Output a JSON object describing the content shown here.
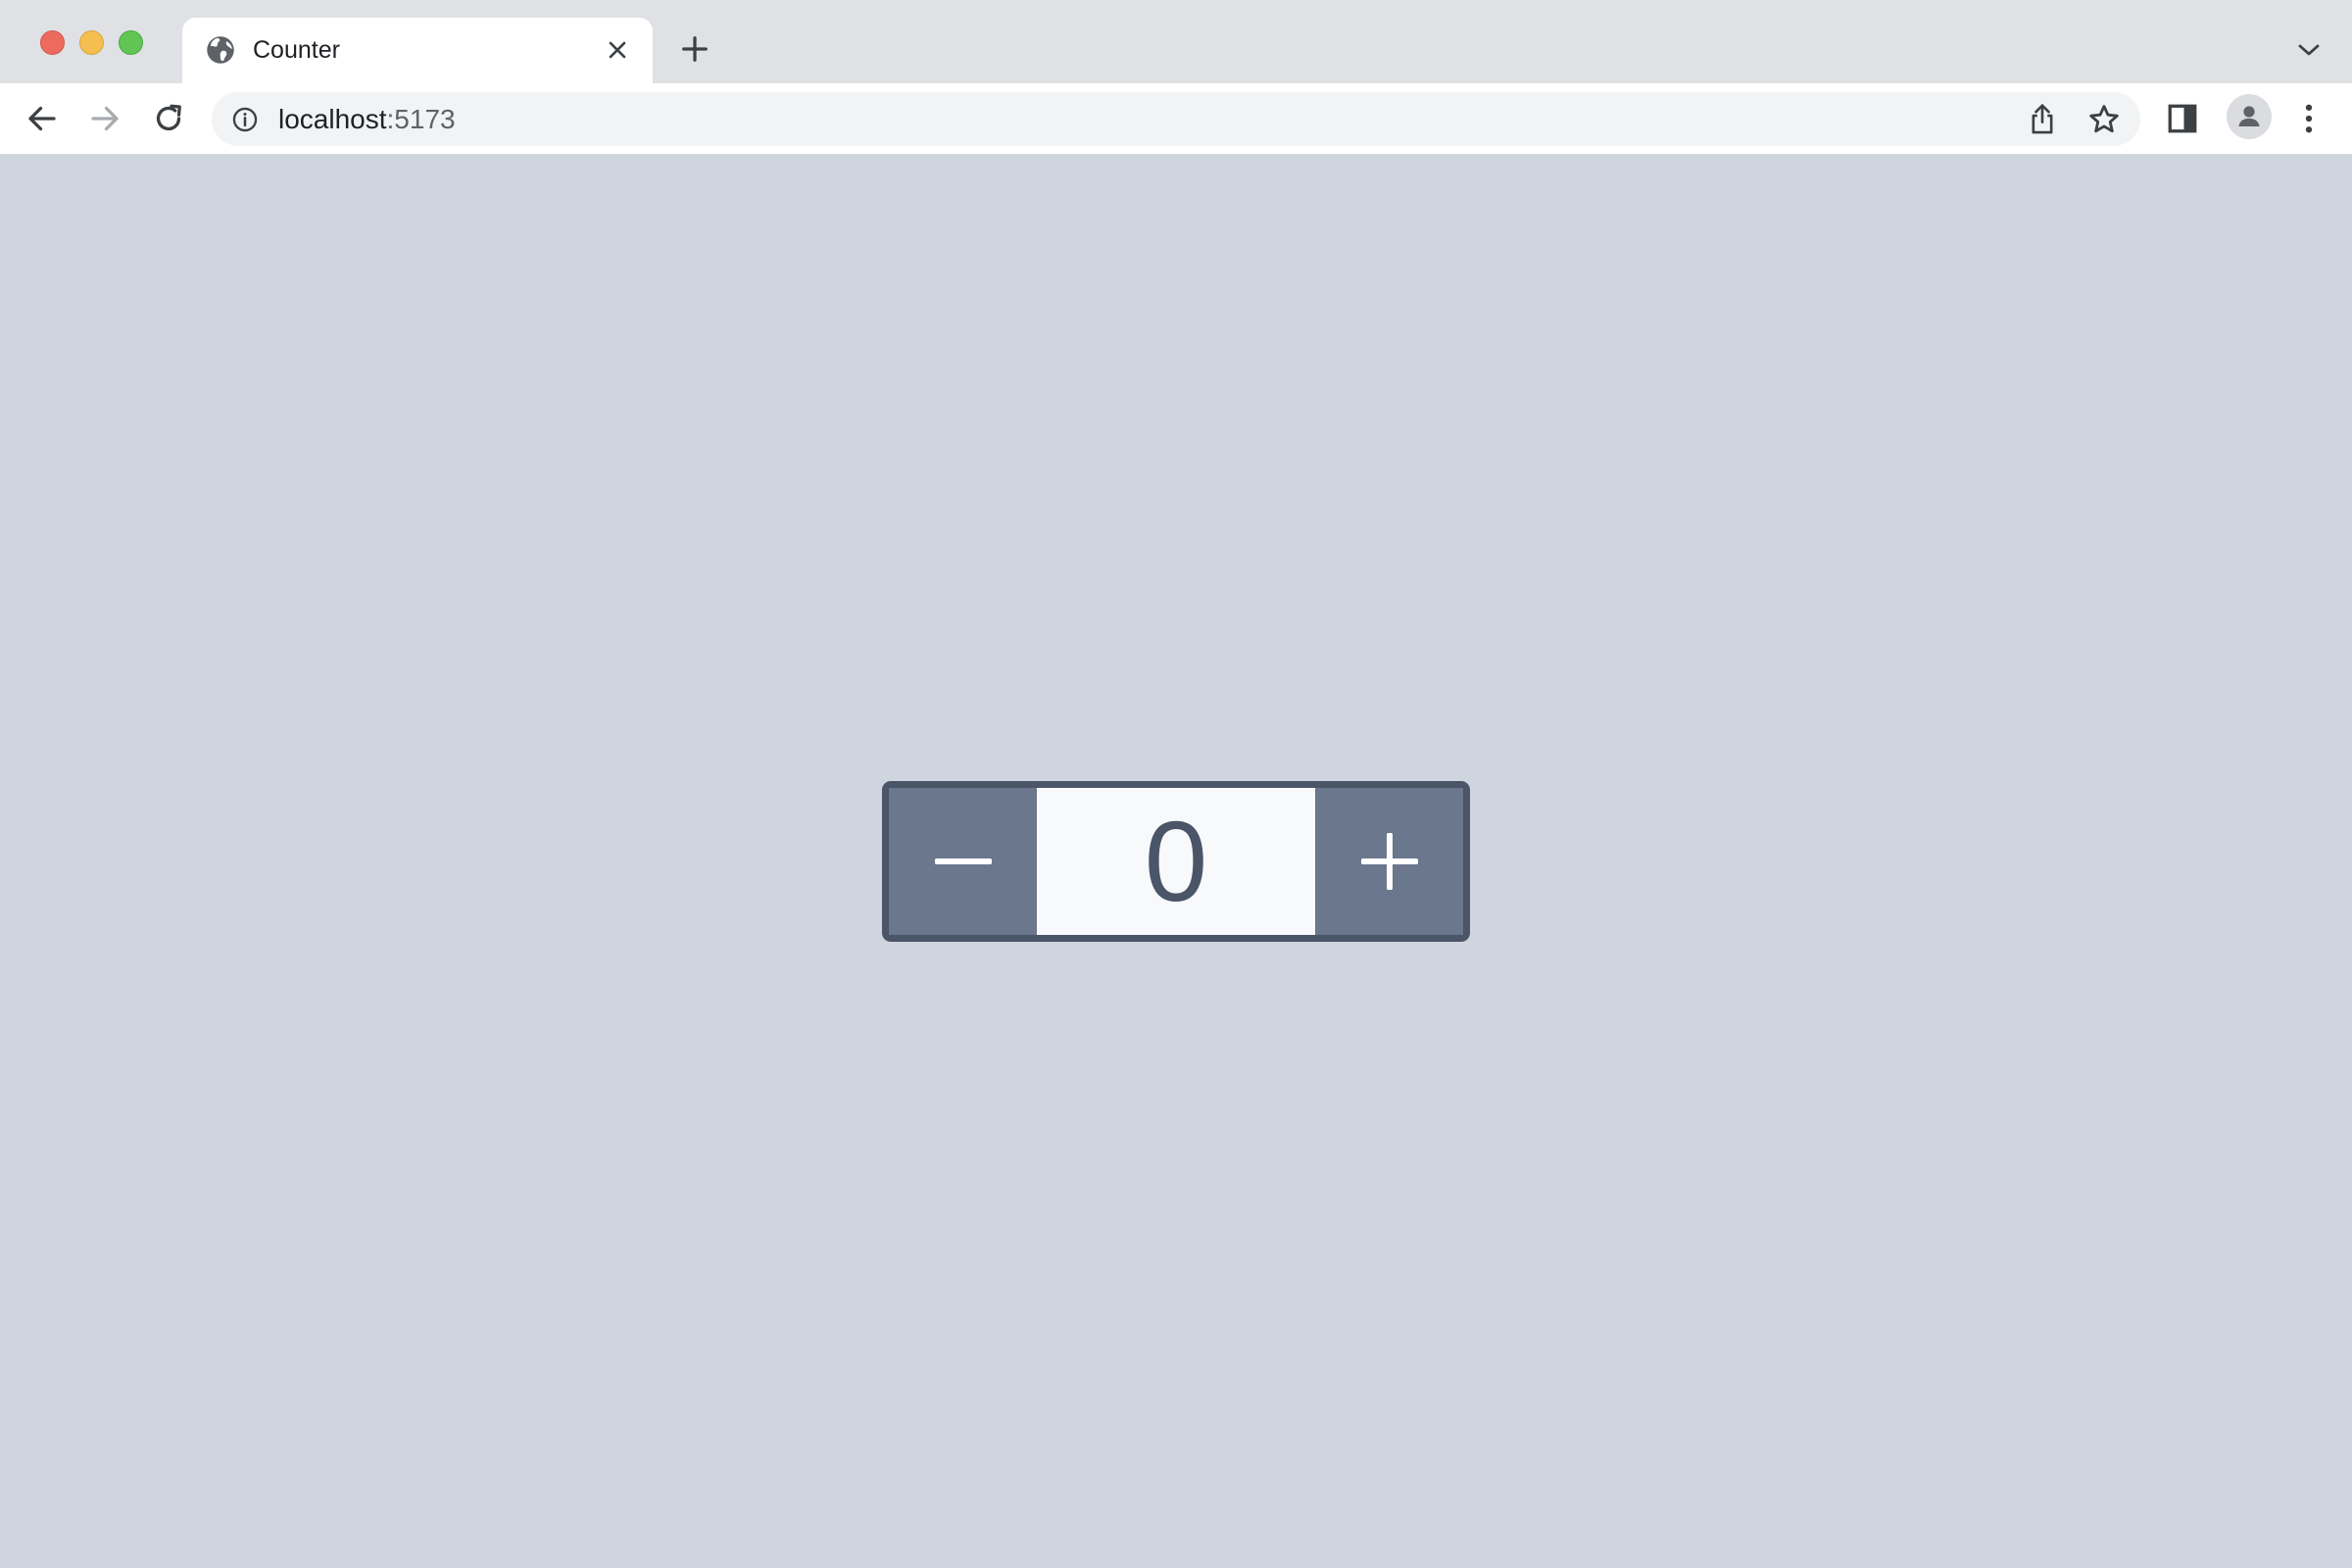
{
  "browser": {
    "tab": {
      "title": "Counter",
      "favicon": "globe-icon"
    },
    "address": {
      "host": "localhost",
      "port": ":5173"
    },
    "icons": {
      "back": "arrow-left-icon",
      "forward": "arrow-right-icon",
      "reload": "reload-icon",
      "info": "info-icon",
      "share": "share-icon",
      "bookmark": "star-icon",
      "side_panel": "side-panel-icon",
      "profile": "profile-icon",
      "menu": "kebab-menu-icon",
      "new_tab": "plus-icon",
      "tab_list": "chevron-down-icon",
      "close_tab": "close-icon"
    }
  },
  "counter": {
    "value": "0",
    "decrement_icon": "minus-icon",
    "increment_icon": "plus-icon"
  },
  "colors": {
    "page_background": "#ced5df",
    "counter_border": "#4a5568",
    "button_background": "#6b778d",
    "value_background": "#f7f9fb",
    "value_text": "#4a5568"
  }
}
